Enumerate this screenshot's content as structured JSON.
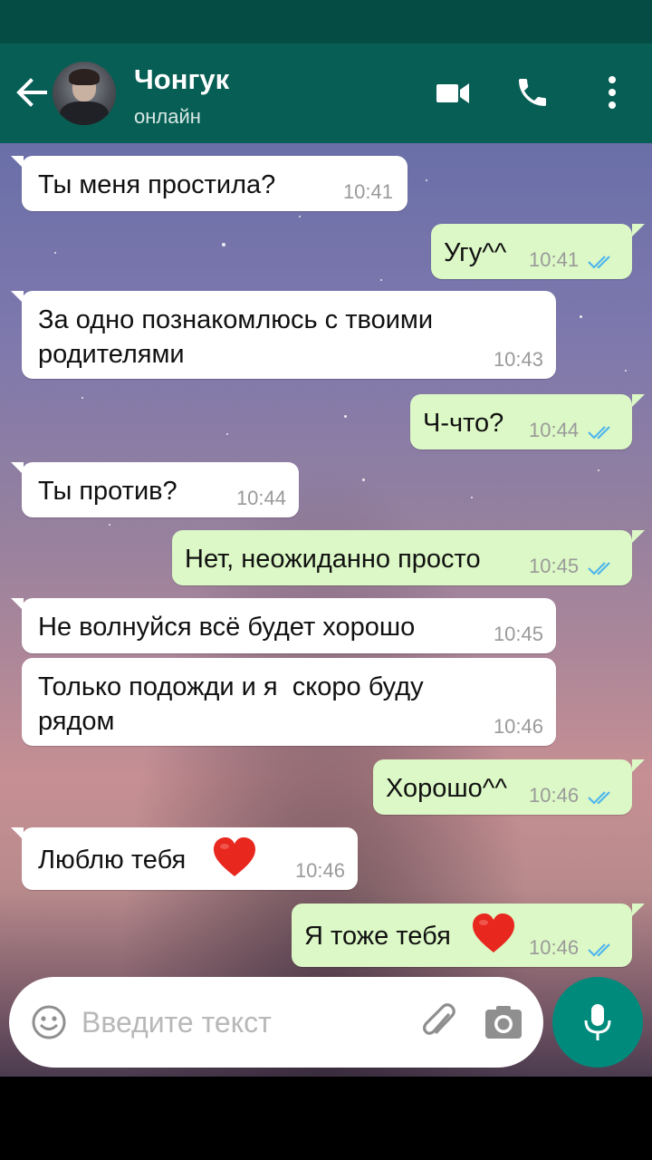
{
  "header": {
    "contact_name": "Чонгук",
    "contact_status": "онлайн",
    "icons": [
      "back-arrow-icon",
      "avatar",
      "video-call-icon",
      "phone-call-icon",
      "more-vert-icon"
    ]
  },
  "messages": [
    {
      "dir": "in",
      "text": "Ты меня простила?",
      "time": "10:41"
    },
    {
      "dir": "out",
      "text": "Угу^^",
      "time": "10:41",
      "read": true
    },
    {
      "dir": "in",
      "text": "За одно познакомлюсь с твоими\nродителями",
      "time": "10:43"
    },
    {
      "dir": "out",
      "text": "Ч-что?",
      "time": "10:44",
      "read": true
    },
    {
      "dir": "in",
      "text": "Ты против?",
      "time": "10:44"
    },
    {
      "dir": "out",
      "text": "Нет, неожиданно просто",
      "time": "10:45",
      "read": true
    },
    {
      "dir": "in",
      "text": "Не волнуйся всё будет хорошо",
      "time": "10:45"
    },
    {
      "dir": "in",
      "text": "Только подожди и я  скоро буду\nрядом",
      "time": "10:46"
    },
    {
      "dir": "out",
      "text": "Хорошо^^",
      "time": "10:46",
      "read": true
    },
    {
      "dir": "in",
      "text": "Люблю тебя",
      "emoji": "heart",
      "time": "10:46"
    },
    {
      "dir": "out",
      "text": "Я тоже тебя",
      "emoji": "heart",
      "time": "10:46",
      "read": true
    }
  ],
  "composer": {
    "placeholder": "Введите текст",
    "icons": [
      "emoji-icon",
      "attach-icon",
      "camera-icon",
      "mic-icon"
    ]
  },
  "colors": {
    "header": "#075e54",
    "status_bar": "#054d44",
    "incoming_bubble": "#ffffff",
    "outgoing_bubble": "#dcf8c6",
    "read_ticks": "#4fb6ec",
    "mic_button": "#008a7c"
  }
}
